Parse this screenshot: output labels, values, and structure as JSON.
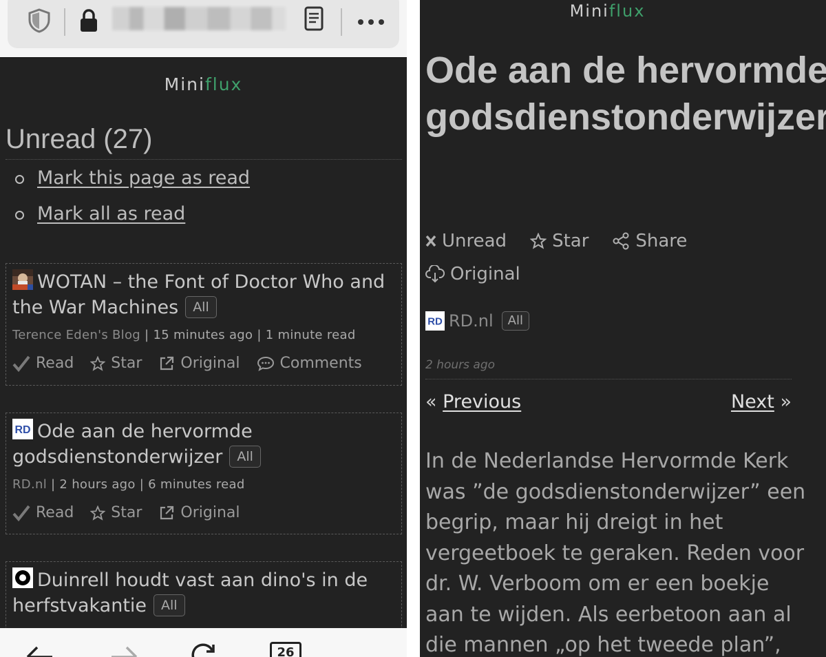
{
  "brand": {
    "part1": "Mini",
    "part2": "flux"
  },
  "left": {
    "title": "Unread (27)",
    "actions": [
      "Mark this page as read",
      "Mark all as read"
    ],
    "entries": [
      {
        "title": "WOTAN – the Font of Doctor Who and the War Machines",
        "tag": "All",
        "source": "Terence Eden's Blog",
        "time": "15 minutes ago",
        "reading": "1 minute read",
        "actions": {
          "read": "Read",
          "star": "Star",
          "original": "Original",
          "comments": "Comments"
        }
      },
      {
        "title": "Ode aan de hervormde godsdienstonderwijzer",
        "tag": "All",
        "source": "RD.nl",
        "time": "2 hours ago",
        "reading": "6 minutes read",
        "actions": {
          "read": "Read",
          "star": "Star",
          "original": "Original"
        }
      },
      {
        "title": "Duinrell houdt vast aan dino's in de herfstvakantie",
        "tag": "All"
      }
    ],
    "tab_count": "26",
    "icons": [
      "shield-icon",
      "lock-icon",
      "reader-icon",
      "more-icon",
      "back-icon",
      "forward-icon",
      "reload-icon",
      "tabs-icon",
      "menu-icon"
    ]
  },
  "right": {
    "title": "Ode aan de hervormde godsdienstonderwijzer",
    "actions": {
      "unread": "Unread",
      "star": "Star",
      "share": "Share",
      "original": "Original"
    },
    "feed": "RD.nl",
    "tag": "All",
    "time": "2 hours ago",
    "prev_arrow": "«",
    "prev": "Previous",
    "next": "Next",
    "next_arrow": "»",
    "body": "In de Nederlandse Hervormde Kerk was ”de godsdienstonderwijzer” een begrip, maar hij dreigt in het vergeetboek te geraken. Reden voor dr. W. Verboom om er een boekje aan te wijden. Als eerbetoon aan al die mannen „op het tweede plan”,"
  },
  "colors": {
    "accent": "#3fa06b",
    "background": "#222222",
    "text": "#bdbdbd"
  }
}
